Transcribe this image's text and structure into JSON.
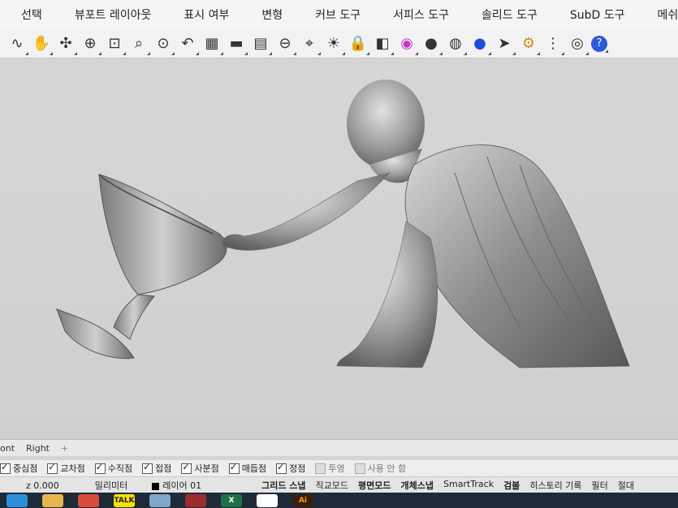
{
  "menubar": {
    "items": [
      "선택",
      "뷰포트 레이아웃",
      "표시 여부",
      "변형",
      "커브 도구",
      "서피스 도구",
      "솔리드 도구",
      "SubD 도구",
      "메쉬 도구"
    ]
  },
  "toolbar": {
    "icons": [
      "curve-icon",
      "pan-hand-icon",
      "rotate-view-icon",
      "zoom-icon",
      "zoom-window-icon",
      "zoom-extents-icon",
      "zoom-selected-icon",
      "undo-view-icon",
      "four-viewports-icon",
      "car-icon",
      "grid-plane-icon",
      "cplane-icon",
      "osnap-icon",
      "light-bulb-icon",
      "lock-icon",
      "layers-icon",
      "color-wheel-icon",
      "sphere-shaded-icon",
      "sphere-wire-icon",
      "sphere-blue-icon",
      "pointer-icon",
      "gear-icon",
      "tree-icon",
      "globe-icon",
      "help-icon"
    ]
  },
  "viewport_tabs": {
    "items": [
      "ont",
      "Right"
    ],
    "add_label": "+"
  },
  "osnap": {
    "items": [
      {
        "label": "중심점",
        "checked": true
      },
      {
        "label": "교차점",
        "checked": true
      },
      {
        "label": "수직점",
        "checked": true
      },
      {
        "label": "접점",
        "checked": true
      },
      {
        "label": "사분점",
        "checked": true
      },
      {
        "label": "매듭점",
        "checked": true
      },
      {
        "label": "정점",
        "checked": true
      },
      {
        "label": "투영",
        "checked": false
      },
      {
        "label": "사용 안 함",
        "checked": false
      }
    ]
  },
  "statusbar": {
    "z_coord": "z 0.000",
    "units": "밀리미터",
    "layer": "레이어 01",
    "buttons": [
      {
        "label": "그리드 스냅",
        "bold": true
      },
      {
        "label": "직교모드",
        "bold": false
      },
      {
        "label": "평면모드",
        "bold": true
      },
      {
        "label": "개체스냅",
        "bold": true
      },
      {
        "label": "SmartTrack",
        "bold": false
      },
      {
        "label": "검볼",
        "bold": true
      },
      {
        "label": "히스토리 기록",
        "bold": false
      },
      {
        "label": "필터",
        "bold": false
      },
      {
        "label": "절대",
        "bold": false
      }
    ]
  },
  "taskbar": {
    "apps": [
      {
        "name": "edge-icon",
        "label": "",
        "color": "#2c8fd8"
      },
      {
        "name": "folder-icon",
        "label": "",
        "color": "#e8b64a"
      },
      {
        "name": "chrome-icon",
        "label": "",
        "color": "#d94b3c"
      },
      {
        "name": "kakaotalk-icon",
        "label": "TALK",
        "color": "#f9e000"
      },
      {
        "name": "cloud-icon",
        "label": "",
        "color": "#7fa7c9"
      },
      {
        "name": "app-icon",
        "label": "",
        "color": "#9b2d2d"
      },
      {
        "name": "excel-icon",
        "label": "X",
        "color": "#1e7145"
      },
      {
        "name": "rhino-icon",
        "label": "",
        "color": "#ffffff"
      },
      {
        "name": "illustrator-icon",
        "label": "Ai",
        "color": "#3b1f0e"
      }
    ]
  }
}
